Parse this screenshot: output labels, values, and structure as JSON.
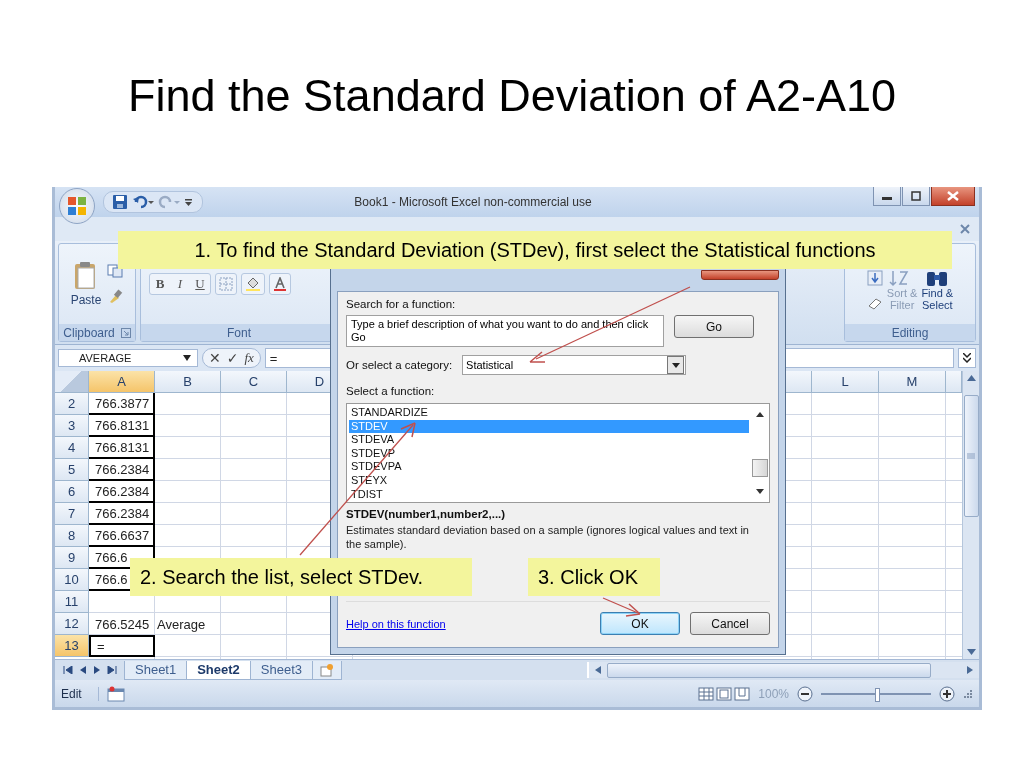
{
  "slide": {
    "title": "Find the Standard Deviation of A2-A10"
  },
  "window": {
    "title": "Book1 - Microsoft Excel non-commercial use"
  },
  "ribbon": {
    "clipboard": {
      "label": "Clipboard",
      "paste": "Paste"
    },
    "font": {
      "label": "Font",
      "format_buttons": [
        "B",
        "I",
        "U"
      ]
    },
    "editing": {
      "label": "Editing",
      "commands": [
        {
          "lines": [
            "Sort &",
            "Filter"
          ],
          "disabled": true
        },
        {
          "lines": [
            "Find &",
            "Select"
          ],
          "disabled": false
        }
      ]
    }
  },
  "formula_bar": {
    "name_box": "AVERAGE",
    "cancel_glyph": "✕",
    "enter_glyph": "✓",
    "function_glyph": "fx",
    "formula": "="
  },
  "sheet": {
    "columns": [
      {
        "label": "A",
        "selected": true
      },
      {
        "label": "B",
        "selected": false
      },
      {
        "label": "C",
        "selected": false
      },
      {
        "label": "D",
        "selected": false
      }
    ],
    "right_columns": [
      {
        "label": "L",
        "selected": false
      },
      {
        "label": "M",
        "selected": false
      }
    ],
    "rows": [
      {
        "header": "2",
        "selected": false,
        "bordered": true,
        "a": "766.3877"
      },
      {
        "header": "3",
        "selected": false,
        "bordered": true,
        "a": "766.8131"
      },
      {
        "header": "4",
        "selected": false,
        "bordered": true,
        "a": "766.8131"
      },
      {
        "header": "5",
        "selected": false,
        "bordered": true,
        "a": "766.2384"
      },
      {
        "header": "6",
        "selected": false,
        "bordered": true,
        "a": "766.2384"
      },
      {
        "header": "7",
        "selected": false,
        "bordered": true,
        "a": "766.2384"
      },
      {
        "header": "8",
        "selected": false,
        "bordered": true,
        "a": "766.6637"
      },
      {
        "header": "9",
        "selected": false,
        "bordered": true,
        "a": "766.6"
      },
      {
        "header": "10",
        "selected": false,
        "bordered": true,
        "a": "766.6"
      },
      {
        "header": "11",
        "selected": false,
        "bordered": false
      },
      {
        "header": "12",
        "selected": false,
        "bordered": false,
        "a": "766.5245",
        "b": "Average"
      },
      {
        "header": "13",
        "selected": true,
        "bordered": false,
        "a": "="
      }
    ]
  },
  "sheet_tabs": [
    {
      "label": "Sheet1",
      "selected": false
    },
    {
      "label": "Sheet2",
      "selected": true
    },
    {
      "label": "Sheet3",
      "selected": false
    }
  ],
  "status_bar": {
    "mode": "Edit",
    "zoom": "100%",
    "zoom_slider": {
      "level": 0.5
    }
  },
  "dialog": {
    "search_label": "Search for a function:",
    "search_value": "Type a brief description of what you want to do and then click Go",
    "go_button": "Go",
    "category_label": "Or select a category:",
    "category_value": "Statistical",
    "function_label": "Select a function:",
    "functions": [
      {
        "name": "STANDARDIZE",
        "selected": false
      },
      {
        "name": "STDEV",
        "selected": true
      },
      {
        "name": "STDEVA",
        "selected": false
      },
      {
        "name": "STDEVP",
        "selected": false
      },
      {
        "name": "STDEVPA",
        "selected": false
      },
      {
        "name": "STEYX",
        "selected": false
      },
      {
        "name": "TDIST",
        "selected": false
      }
    ],
    "signature": "STDEV(number1,number2,...)",
    "description": "Estimates standard deviation based on a sample (ignores logical values and text in the sample).",
    "help_link": "Help on this function",
    "buttons": [
      {
        "label": "OK",
        "default": true
      },
      {
        "label": "Cancel",
        "default": false
      }
    ]
  },
  "callouts": [
    {
      "text": "1. To find the Standard Deviation (STDev), first select the Statistical functions"
    },
    {
      "text": "2. Search the list, select STDev."
    },
    {
      "text": "3. Click OK"
    }
  ]
}
